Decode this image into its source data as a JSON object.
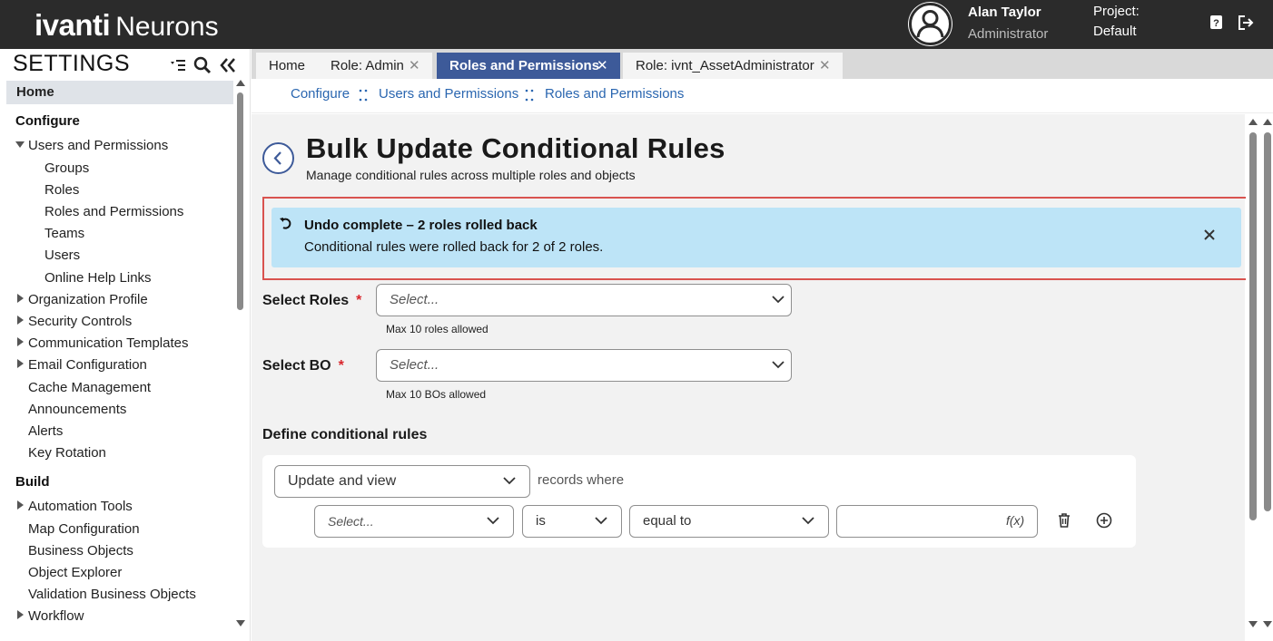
{
  "header": {
    "logo_bold": "ivanti",
    "logo_light": "Neurons",
    "user_name": "Alan Taylor",
    "user_role": "Administrator",
    "project_label": "Project:",
    "project_value": "Default",
    "icons": [
      "user-avatar-icon",
      "help-icon",
      "logout-icon"
    ]
  },
  "sidebar": {
    "title": "SETTINGS",
    "tool_icons": [
      "tree-toggle-icon",
      "search-icon",
      "collapse-double-chevron-icon"
    ],
    "home": "Home",
    "configure_heading": "Configure",
    "configure_items": [
      "Users and Permissions",
      "Groups",
      "Roles",
      "Roles and Permissions",
      "Teams",
      "Users",
      "Online Help Links",
      "Organization Profile",
      "Security Controls",
      "Communication Templates",
      "Email Configuration",
      "Cache Management",
      "Announcements",
      "Alerts",
      "Key Rotation"
    ],
    "build_heading": "Build",
    "build_items": [
      "Automation Tools",
      "Map Configuration",
      "Business Objects",
      "Object Explorer",
      "Validation Business Objects",
      "Workflow"
    ]
  },
  "tabs": [
    {
      "label": "Home",
      "closable": false
    },
    {
      "label": "Role: Admin",
      "closable": true
    },
    {
      "label": "Roles and Permissions",
      "closable": true,
      "active": true
    },
    {
      "label": "Role: ivnt_AssetAdministrator",
      "closable": true
    }
  ],
  "tab_close_glyph": "✕",
  "breadcrumb": [
    "Configure",
    "Users and Permissions",
    "Roles and Permissions"
  ],
  "page": {
    "title": "Bulk Update Conditional Rules",
    "subtitle": "Manage conditional rules across multiple roles and objects",
    "banner_heading": "Undo complete – 2 roles rolled back",
    "banner_body": "Conditional rules were rolled back for 2 of 2 roles.",
    "select_roles_label": "Select Roles",
    "select_roles_placeholder": "Select...",
    "select_roles_hint": "Max 10 roles allowed",
    "select_bo_label": "Select BO",
    "select_bo_placeholder": "Select...",
    "select_bo_hint": "Max 10 BOs allowed",
    "required_marker": "*",
    "section_title": "Define conditional rules",
    "rule_action_value": "Update and view",
    "records_where": "records where",
    "field_placeholder": "Select...",
    "operator_value": "is",
    "comparison_value": "equal to",
    "value_input": "",
    "fx_label": "f(x)"
  },
  "colors": {
    "topbar_bg": "#2b2b2b",
    "tab_active_bg": "#3d5a99",
    "link": "#2a66b0",
    "banner_bg": "#bde4f7",
    "banner_border": "#d9534f",
    "required": "#d9262c"
  }
}
